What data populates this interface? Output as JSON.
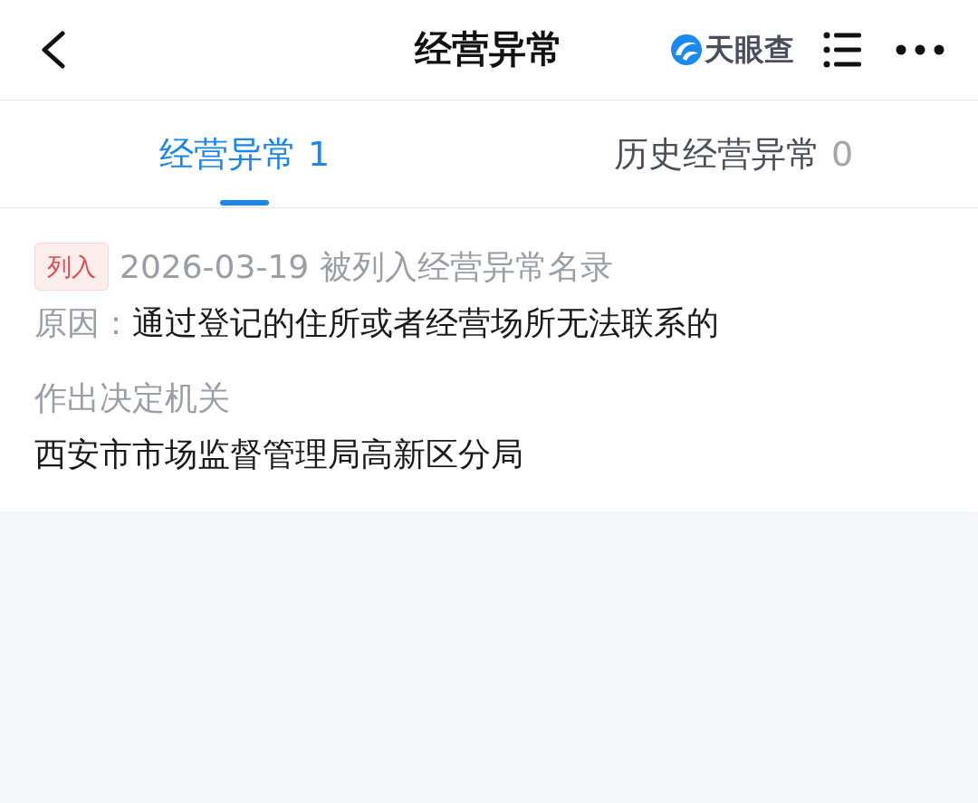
{
  "header": {
    "title": "经营异常",
    "logo_text": "天眼查"
  },
  "tabs": [
    {
      "label": "经营异常",
      "count": "1",
      "selected": true
    },
    {
      "label": "历史经营异常",
      "count": "0",
      "selected": false
    }
  ],
  "record": {
    "tag": "列入",
    "summary": "2026-03-19 被列入经营异常名录",
    "reason_label": "原因：",
    "reason": "通过登记的住所或者经营场所无法联系的",
    "authority_label": "作出决定机关",
    "authority": "西安市市场监督管理局高新区分局"
  }
}
